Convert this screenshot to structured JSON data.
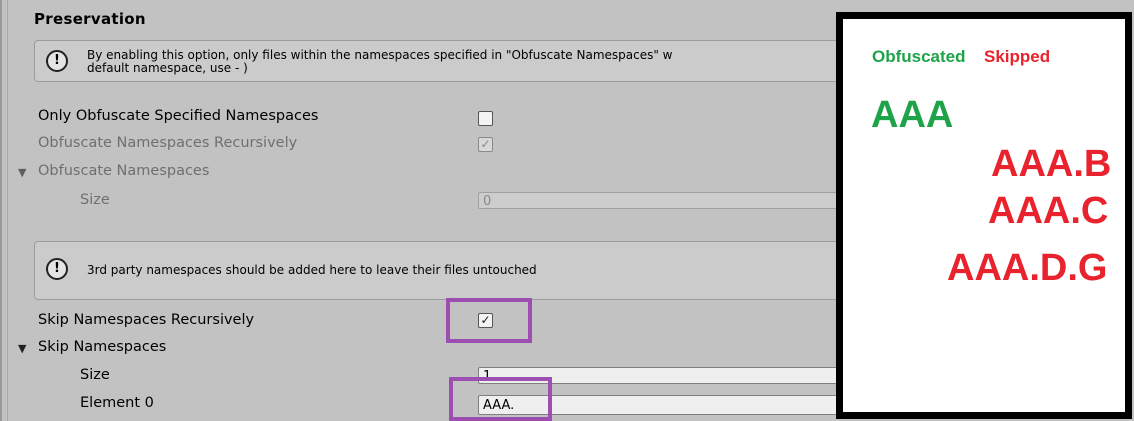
{
  "section": {
    "title": "Preservation"
  },
  "help1": {
    "icon": "info-icon",
    "line1": "By enabling this option, only files within the namespaces specified in \"Obfuscate Namespaces\" w",
    "line2": "default namespace, use - )"
  },
  "only_obfuscate": {
    "label": "Only Obfuscate Specified Namespaces",
    "checked": false
  },
  "obfuscate_recursive": {
    "label": "Obfuscate Namespaces Recursively",
    "checked": true,
    "check_glyph": "✓"
  },
  "obfuscate_namespaces": {
    "label": "Obfuscate Namespaces",
    "size_label": "Size",
    "size_value": "0"
  },
  "help2": {
    "icon": "info-icon",
    "text": "3rd party namespaces should be added here to leave their files untouched"
  },
  "skip_recursive": {
    "label": "Skip Namespaces Recursively",
    "checked": true,
    "check_glyph": "✓"
  },
  "skip_namespaces": {
    "label": "Skip Namespaces",
    "size_label": "Size",
    "size_value": "1",
    "element_label": "Element 0",
    "element_value": "AAA."
  },
  "foldout_glyph": "▼",
  "legend": {
    "obfuscated": "Obfuscated",
    "skipped": "Skipped",
    "items": [
      "AAA",
      "AAA.B",
      "AAA.C",
      "AAA.D.G"
    ]
  },
  "colors": {
    "obfuscated": "#1fa349",
    "skipped": "#e8232e",
    "highlight": "#9c4fb0"
  }
}
